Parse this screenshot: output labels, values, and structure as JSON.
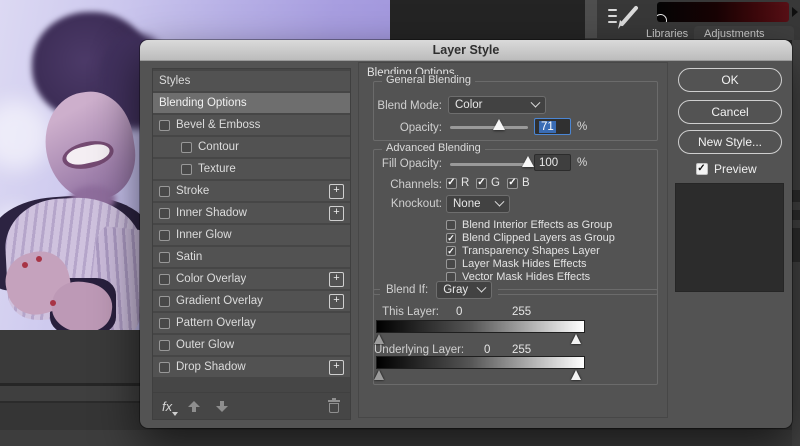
{
  "window": {
    "title": "Layer Style"
  },
  "background": {
    "panel_tabs": [
      {
        "label": "Libraries"
      },
      {
        "label": "Adjustments"
      }
    ],
    "gradient_swatch_colors": [
      "#050505",
      "#571016"
    ],
    "duotone_purple": "#a89ee0"
  },
  "dialog": {
    "title": "Layer Style",
    "styles_panel": {
      "items": [
        {
          "label": "Styles",
          "type": "header"
        },
        {
          "label": "Blending Options",
          "selected": true
        },
        {
          "label": "Bevel & Emboss",
          "checkbox": true,
          "checked": false
        },
        {
          "label": "Contour",
          "checkbox": true,
          "checked": false,
          "indent": true
        },
        {
          "label": "Texture",
          "checkbox": true,
          "checked": false,
          "indent": true
        },
        {
          "label": "Stroke",
          "checkbox": true,
          "checked": false,
          "plus": true
        },
        {
          "label": "Inner Shadow",
          "checkbox": true,
          "checked": false,
          "plus": true
        },
        {
          "label": "Inner Glow",
          "checkbox": true,
          "checked": false
        },
        {
          "label": "Satin",
          "checkbox": true,
          "checked": false
        },
        {
          "label": "Color Overlay",
          "checkbox": true,
          "checked": false,
          "plus": true
        },
        {
          "label": "Gradient Overlay",
          "checkbox": true,
          "checked": false,
          "plus": true
        },
        {
          "label": "Pattern Overlay",
          "checkbox": true,
          "checked": false
        },
        {
          "label": "Outer Glow",
          "checkbox": true,
          "checked": false
        },
        {
          "label": "Drop Shadow",
          "checkbox": true,
          "checked": false,
          "plus": true
        }
      ],
      "footer_fx_label": "fx",
      "plus_glyph": "+"
    },
    "content": {
      "heading": "Blending Options",
      "general_blending": {
        "group_label": "General Blending",
        "blend_mode_label": "Blend Mode:",
        "blend_mode_value": "Color",
        "opacity_label": "Opacity:",
        "opacity_value": "71",
        "opacity_unit": "%",
        "opacity_percent": 71
      },
      "advanced_blending": {
        "group_label": "Advanced Blending",
        "fill_opacity_label": "Fill Opacity:",
        "fill_opacity_value": "100",
        "fill_opacity_unit": "%",
        "fill_opacity_percent": 100,
        "channels_label": "Channels:",
        "channels": [
          {
            "label": "R",
            "checked": true
          },
          {
            "label": "G",
            "checked": true
          },
          {
            "label": "B",
            "checked": true
          }
        ],
        "knockout_label": "Knockout:",
        "knockout_value": "None",
        "options": [
          {
            "label": "Blend Interior Effects as Group",
            "checked": false
          },
          {
            "label": "Blend Clipped Layers as Group",
            "checked": true
          },
          {
            "label": "Transparency Shapes Layer",
            "checked": true
          },
          {
            "label": "Layer Mask Hides Effects",
            "checked": false
          },
          {
            "label": "Vector Mask Hides Effects",
            "checked": false
          }
        ]
      },
      "blend_if": {
        "label": "Blend If:",
        "channel_value": "Gray",
        "this_layer_label": "This Layer:",
        "this_layer_min": "0",
        "this_layer_max": "255",
        "underlying_layer_label": "Underlying Layer:",
        "underlying_min": "0",
        "underlying_max": "255"
      }
    },
    "actions": {
      "ok_label": "OK",
      "cancel_label": "Cancel",
      "new_style_label": "New Style...",
      "preview_label": "Preview",
      "preview_checked": true
    }
  },
  "colors": {
    "dialog_bg": "#535353",
    "selection_blue": "#3a6cb4",
    "focus_border": "#4b86d4"
  }
}
